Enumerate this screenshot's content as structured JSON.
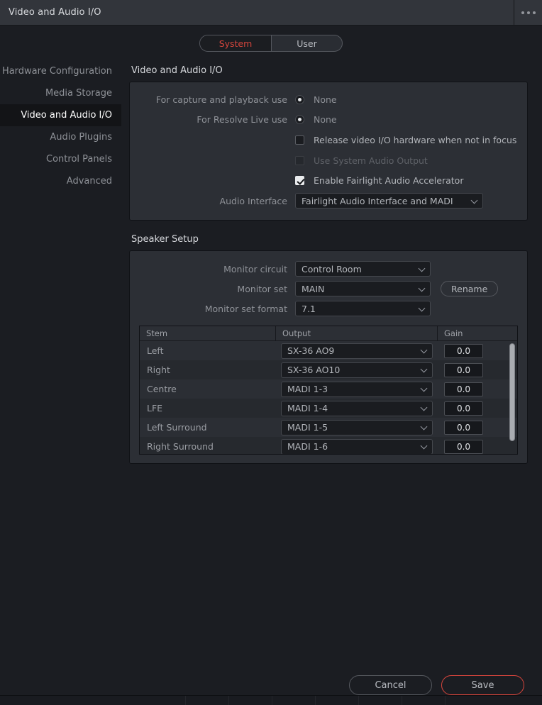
{
  "window": {
    "title": "Video and Audio I/O",
    "menu_icon": "ellipsis-icon"
  },
  "toggle": {
    "options": [
      "System",
      "User"
    ],
    "active": "System",
    "active_color": "#d4453c"
  },
  "sidebar": {
    "items": [
      {
        "label": "Hardware Configuration",
        "active": false
      },
      {
        "label": "Media Storage",
        "active": false
      },
      {
        "label": "Video and Audio I/O",
        "active": true
      },
      {
        "label": "Audio Plugins",
        "active": false
      },
      {
        "label": "Control Panels",
        "active": false
      },
      {
        "label": "Advanced",
        "active": false
      }
    ]
  },
  "video_audio_io": {
    "section_title": "Video and Audio I/O",
    "capture_playback": {
      "label": "For capture and playback use",
      "value": "None",
      "selected": true
    },
    "resolve_live": {
      "label": "For Resolve Live use",
      "value": "None",
      "selected": true
    },
    "release_hardware": {
      "label": "Release video I/O hardware when not in focus",
      "checked": false,
      "disabled": false
    },
    "use_system_audio": {
      "label": "Use System Audio Output",
      "checked": false,
      "disabled": true
    },
    "enable_fairlight": {
      "label": "Enable Fairlight Audio Accelerator",
      "checked": true,
      "disabled": false
    },
    "audio_interface": {
      "label": "Audio Interface",
      "value": "Fairlight Audio Interface and MADI"
    }
  },
  "speaker_setup": {
    "section_title": "Speaker Setup",
    "monitor_circuit": {
      "label": "Monitor circuit",
      "value": "Control Room"
    },
    "monitor_set": {
      "label": "Monitor set",
      "value": "MAIN"
    },
    "rename_label": "Rename",
    "monitor_set_format": {
      "label": "Monitor set format",
      "value": "7.1"
    },
    "table": {
      "headers": [
        "Stem",
        "Output",
        "Gain"
      ],
      "rows": [
        {
          "stem": "Left",
          "output": "SX-36 AO9",
          "gain": "0.0"
        },
        {
          "stem": "Right",
          "output": "SX-36 AO10",
          "gain": "0.0"
        },
        {
          "stem": "Centre",
          "output": "MADI 1-3",
          "gain": "0.0"
        },
        {
          "stem": "LFE",
          "output": "MADI 1-4",
          "gain": "0.0"
        },
        {
          "stem": "Left Surround",
          "output": "MADI 1-5",
          "gain": "0.0"
        },
        {
          "stem": "Right Surround",
          "output": "MADI 1-6",
          "gain": "0.0"
        }
      ]
    }
  },
  "footer": {
    "cancel_label": "Cancel",
    "save_label": "Save",
    "save_accent": "#d9453c"
  }
}
